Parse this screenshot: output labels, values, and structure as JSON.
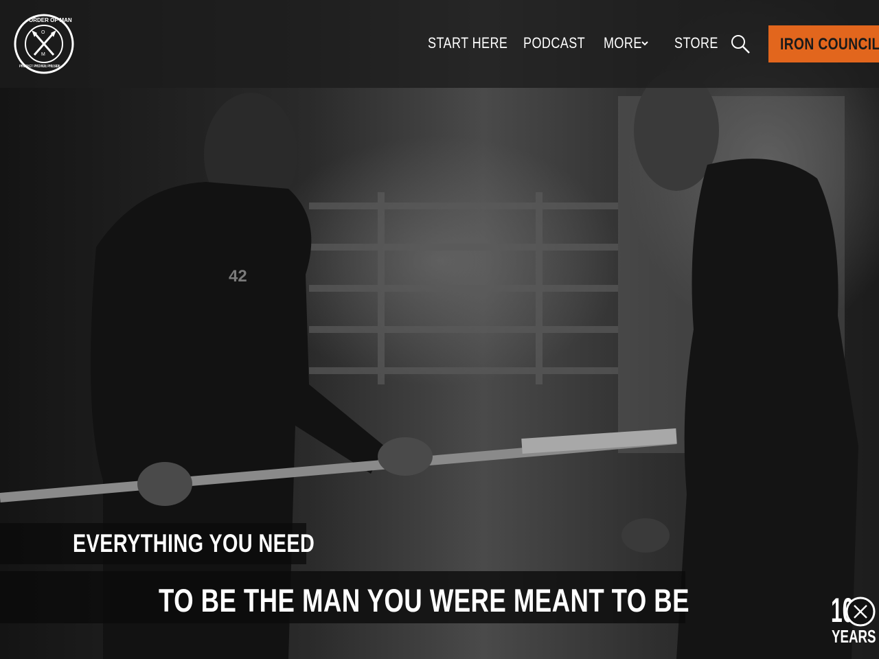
{
  "brand": {
    "logo_text_top": "ORDER OF MAN",
    "logo_text_bottom": "PROTECT PROVIDE PRESIDE",
    "logo_initials": [
      "O",
      "M"
    ]
  },
  "nav": {
    "items": [
      {
        "label": "START HERE"
      },
      {
        "label": "PODCAST"
      },
      {
        "label": "MORE"
      },
      {
        "label": "STORE"
      }
    ],
    "search_icon": "search-icon",
    "cta_label": "IRON COUNCIL"
  },
  "hero": {
    "headline_line1": "EVERYTHING YOU NEED",
    "headline_line2": "TO BE THE MAN YOU WERE MEANT TO BE",
    "shirt_number": "42"
  },
  "badge": {
    "number": "10",
    "label": "YEARS"
  },
  "colors": {
    "accent": "#e2661d",
    "nav_bg": "#1c1c1c",
    "text": "#ffffff"
  }
}
